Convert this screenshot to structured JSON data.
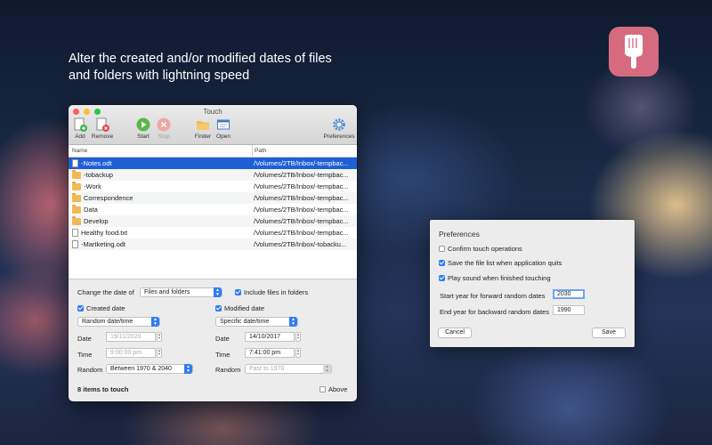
{
  "headline": "Alter the created and/or modified dates of files and folders with lightning speed",
  "window": {
    "title": "Touch",
    "toolbar": {
      "add": "Add",
      "remove": "Remove",
      "start": "Start",
      "stop": "Stop",
      "finder": "Finder",
      "open": "Open",
      "preferences": "Preferences"
    },
    "columns": {
      "name": "Name",
      "path": "Path"
    },
    "files": [
      {
        "name": "-Notes.odt",
        "path": "/Volumes/2TB/Inbox/-tempbac...",
        "kind": "doc",
        "selected": true
      },
      {
        "name": "-tobackup",
        "path": "/Volumes/2TB/Inbox/-tempbac...",
        "kind": "folder"
      },
      {
        "name": "-Work",
        "path": "/Volumes/2TB/Inbox/-tempbac...",
        "kind": "folder"
      },
      {
        "name": "Correspondence",
        "path": "/Volumes/2TB/Inbox/-tempbac...",
        "kind": "folder"
      },
      {
        "name": "Data",
        "path": "/Volumes/2TB/Inbox/-tempbac...",
        "kind": "folder"
      },
      {
        "name": "Develop",
        "path": "/Volumes/2TB/Inbox/-tempbac...",
        "kind": "folder"
      },
      {
        "name": "Healthy food.txt",
        "path": "/Volumes/2TB/Inbox/-tempbac...",
        "kind": "doc"
      },
      {
        "name": "-Martketing.odt",
        "path": "/Volumes/2TB/Inbox/-tobacku...",
        "kind": "doc"
      }
    ],
    "options": {
      "change_label": "Change the date of",
      "change_value": "Files and folders",
      "include_label": "Include files in folders",
      "created": {
        "label": "Created date",
        "mode": "Random date/time",
        "date_label": "Date",
        "date": "19/11/2020",
        "time_label": "Time",
        "time": "9:00:00 pm",
        "random_label": "Random",
        "random": "Between 1970 & 2040"
      },
      "modified": {
        "label": "Modified date",
        "mode": "Specific date/time",
        "date_label": "Date",
        "date": "14/10/2017",
        "time_label": "Time",
        "time": "7:41:00 pm",
        "random_label": "Random",
        "random": "Past to 1970"
      },
      "items_count": "8 items to touch",
      "above_label": "Above"
    }
  },
  "prefs": {
    "title": "Preferences",
    "confirm": "Confirm touch operations",
    "save_list": "Save the file list when application quits",
    "play_sound": "Play sound when finished touching",
    "start_year_label": "Start year for forward random dates",
    "start_year": "2030",
    "end_year_label": "End year for backward random dates",
    "end_year": "1990",
    "cancel": "Cancel",
    "save": "Save"
  },
  "colors": {
    "accent": "#2f7df6",
    "selection": "#1f5fd6",
    "app_icon": "#d66b7f"
  },
  "icons": [
    "hand-pointing-icon",
    "add-file-icon",
    "remove-file-icon",
    "play-icon",
    "stop-icon",
    "folder-icon",
    "open-window-icon",
    "gear-icon"
  ]
}
